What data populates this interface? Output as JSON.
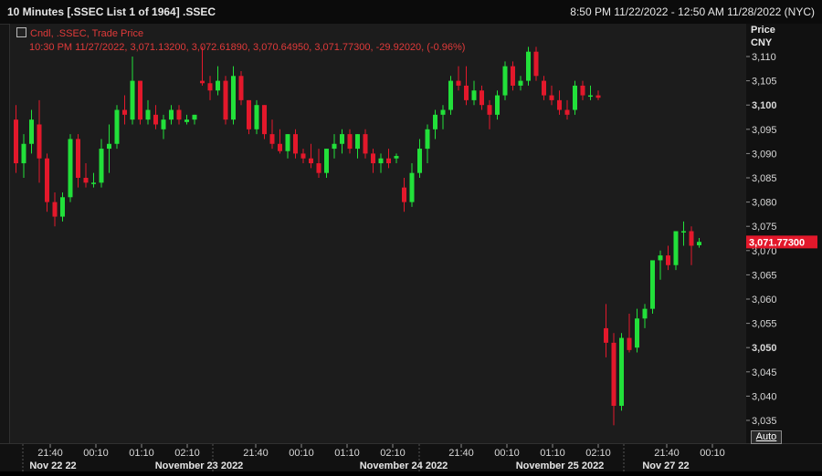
{
  "window": {
    "title": "10 Minutes [.SSEC List 1 of 1964] .SSEC",
    "time_range": "8:50 PM 11/22/2022 - 12:50 AM 11/28/2022 (NYC)"
  },
  "legend": {
    "series": "Cndl, .SSEC, Trade Price",
    "values": "10:30 PM 11/27/2022, 3,071.13200, 3,072.61890, 3,070.64950, 3,071.77300, -29.92020, (-0.96%)"
  },
  "axis": {
    "header_line1": "Price",
    "header_line2": "CNY",
    "last_price_label": "3,071.77300",
    "auto_label": "Auto"
  },
  "colors": {
    "up": "#22e03a",
    "down": "#e3182b",
    "last": "#e3182b",
    "legend": "#e03a3a"
  },
  "chart_data": {
    "type": "candlestick",
    "title": "10 Minutes [.SSEC List 1 of 1964] .SSEC",
    "ylabel": "Price CNY",
    "ylim": [
      3033,
      3113
    ],
    "y_ticks": [
      3035,
      3040,
      3045,
      3050,
      3055,
      3060,
      3065,
      3070,
      3075,
      3080,
      3085,
      3090,
      3095,
      3100,
      3105,
      3110
    ],
    "y_tick_labels": [
      "3,035",
      "3,040",
      "3,045",
      "3,050",
      "3,055",
      "3,060",
      "3,065",
      "3,070",
      "3,075",
      "3,080",
      "3,085",
      "3,090",
      "3,095",
      "3,100",
      "3,105",
      "3,110"
    ],
    "bold_ticks": [
      "3,050",
      "3,100"
    ],
    "x_time_labels": [
      "21:40",
      "00:10",
      "01:10",
      "02:10",
      "21:40",
      "00:10",
      "01:10",
      "02:10",
      "21:40",
      "00:10",
      "01:10",
      "02:10",
      "21:40",
      "00:10"
    ],
    "x_date_labels": [
      "Nov 22 22",
      "November 23 2022",
      "November 24 2022",
      "November 25 2022",
      "Nov 27 22"
    ],
    "grid": false,
    "last_price": 3071.773,
    "candles": [
      [
        3097.0,
        3100.0,
        3086.0,
        3088.0
      ],
      [
        3088.0,
        3094.0,
        3085.0,
        3092.0
      ],
      [
        3092.0,
        3099.0,
        3090.0,
        3097.0
      ],
      [
        3096.0,
        3101.0,
        3084.0,
        3089.0
      ],
      [
        3089.0,
        3090.0,
        3078.0,
        3080.0
      ],
      [
        3080.0,
        3082.0,
        3075.0,
        3077.0
      ],
      [
        3077.0,
        3082.0,
        3076.0,
        3081.0
      ],
      [
        3081.0,
        3094.0,
        3080.0,
        3093.0
      ],
      [
        3093.0,
        3094.0,
        3083.0,
        3085.0
      ],
      [
        3085.0,
        3088.0,
        3083.0,
        3084.0
      ],
      [
        3084.0,
        3086.0,
        3083.0,
        3084.0
      ],
      [
        3084.0,
        3093.0,
        3083.0,
        3091.0
      ],
      [
        3091.0,
        3096.0,
        3086.0,
        3092.0
      ],
      [
        3092.0,
        3100.0,
        3091.0,
        3099.0
      ],
      [
        3099.0,
        3102.0,
        3096.0,
        3098.0
      ],
      [
        3097.0,
        3110.0,
        3096.0,
        3105.0
      ],
      [
        3105.0,
        3105.0,
        3096.0,
        3097.0
      ],
      [
        3097.0,
        3101.0,
        3096.0,
        3099.0
      ],
      [
        3098.0,
        3100.0,
        3095.0,
        3096.0
      ],
      [
        3095.0,
        3098.0,
        3093.0,
        3097.0
      ],
      [
        3097.0,
        3100.0,
        3096.0,
        3099.0
      ],
      [
        3099.0,
        3100.0,
        3096.0,
        3097.0
      ],
      [
        3096.5,
        3098.0,
        3096.0,
        3097.0
      ],
      [
        3097.0,
        3098.0,
        3096.0,
        3098.0
      ],
      [
        3105.0,
        3112.0,
        3104.0,
        3104.5
      ],
      [
        3104.5,
        3106.0,
        3101.0,
        3103.0
      ],
      [
        3103.0,
        3108.0,
        3102.0,
        3105.0
      ],
      [
        3105.0,
        3106.0,
        3096.0,
        3097.0
      ],
      [
        3097.0,
        3108.0,
        3096.0,
        3106.0
      ],
      [
        3106.0,
        3107.0,
        3100.0,
        3101.0
      ],
      [
        3101.0,
        3101.0,
        3094.0,
        3095.0
      ],
      [
        3095.0,
        3101.0,
        3094.0,
        3100.0
      ],
      [
        3100.0,
        3100.0,
        3093.0,
        3094.0
      ],
      [
        3094.0,
        3097.0,
        3091.0,
        3092.0
      ],
      [
        3092.0,
        3095.0,
        3090.0,
        3090.5
      ],
      [
        3090.5,
        3094.0,
        3089.0,
        3094.0
      ],
      [
        3094.0,
        3095.0,
        3089.0,
        3090.0
      ],
      [
        3090.0,
        3091.0,
        3088.0,
        3089.0
      ],
      [
        3089.0,
        3092.0,
        3087.0,
        3088.0
      ],
      [
        3088.0,
        3091.0,
        3085.0,
        3086.0
      ],
      [
        3086.0,
        3091.0,
        3085.0,
        3091.0
      ],
      [
        3091.0,
        3094.0,
        3089.0,
        3092.0
      ],
      [
        3092.0,
        3095.0,
        3090.0,
        3094.0
      ],
      [
        3094.0,
        3095.0,
        3090.0,
        3091.0
      ],
      [
        3091.0,
        3094.0,
        3089.0,
        3094.0
      ],
      [
        3094.0,
        3095.0,
        3089.0,
        3090.0
      ],
      [
        3090.0,
        3091.0,
        3086.0,
        3088.0
      ],
      [
        3088.0,
        3090.0,
        3086.0,
        3089.0
      ],
      [
        3089.0,
        3091.0,
        3087.0,
        3088.0
      ],
      [
        3089.0,
        3090.0,
        3088.0,
        3089.5
      ],
      [
        3083.0,
        3085.0,
        3078.0,
        3080.0
      ],
      [
        3080.0,
        3088.0,
        3079.0,
        3086.0
      ],
      [
        3086.0,
        3093.0,
        3085.0,
        3091.0
      ],
      [
        3091.0,
        3096.0,
        3088.0,
        3095.0
      ],
      [
        3095.0,
        3099.0,
        3093.0,
        3098.0
      ],
      [
        3098.0,
        3100.0,
        3095.0,
        3099.0
      ],
      [
        3099.0,
        3106.0,
        3098.0,
        3105.0
      ],
      [
        3105.0,
        3108.0,
        3103.0,
        3104.0
      ],
      [
        3104.0,
        3108.0,
        3100.0,
        3101.0
      ],
      [
        3101.0,
        3105.0,
        3100.0,
        3103.0
      ],
      [
        3103.0,
        3104.0,
        3099.0,
        3100.0
      ],
      [
        3100.0,
        3101.0,
        3095.0,
        3098.0
      ],
      [
        3098.0,
        3103.0,
        3097.0,
        3102.0
      ],
      [
        3102.0,
        3109.0,
        3101.0,
        3108.0
      ],
      [
        3108.0,
        3109.0,
        3103.0,
        3104.0
      ],
      [
        3104.0,
        3106.0,
        3103.0,
        3105.0
      ],
      [
        3105.0,
        3112.0,
        3104.0,
        3111.0
      ],
      [
        3111.0,
        3112.0,
        3105.0,
        3106.0
      ],
      [
        3105.0,
        3106.0,
        3101.0,
        3102.0
      ],
      [
        3102.0,
        3104.0,
        3100.0,
        3101.0
      ],
      [
        3101.0,
        3103.0,
        3098.0,
        3099.0
      ],
      [
        3099.0,
        3101.0,
        3097.0,
        3098.0
      ],
      [
        3099.0,
        3105.0,
        3098.0,
        3104.0
      ],
      [
        3104.0,
        3105.0,
        3101.0,
        3102.0
      ],
      [
        3102.0,
        3104.0,
        3101.0,
        3102.0
      ],
      [
        3102.0,
        3103.0,
        3101.0,
        3101.5
      ],
      [
        3054.0,
        3059.0,
        3048.0,
        3051.0
      ],
      [
        3051.0,
        3053.0,
        3034.0,
        3038.0
      ],
      [
        3038.0,
        3053.0,
        3037.0,
        3052.0
      ],
      [
        3052.0,
        3057.0,
        3049.0,
        3049.5
      ],
      [
        3050.0,
        3058.0,
        3049.0,
        3056.0
      ],
      [
        3056.0,
        3059.0,
        3054.0,
        3058.0
      ],
      [
        3058.0,
        3067.0,
        3057.0,
        3068.0
      ],
      [
        3068.0,
        3070.0,
        3064.0,
        3069.0
      ],
      [
        3069.0,
        3071.0,
        3066.0,
        3067.0
      ],
      [
        3067.0,
        3074.0,
        3066.0,
        3074.0
      ],
      [
        3074.0,
        3076.0,
        3071.0,
        3074.0
      ],
      [
        3074.0,
        3075.0,
        3067.0,
        3071.0
      ],
      [
        3071.1,
        3072.6,
        3070.6,
        3071.8
      ]
    ]
  }
}
